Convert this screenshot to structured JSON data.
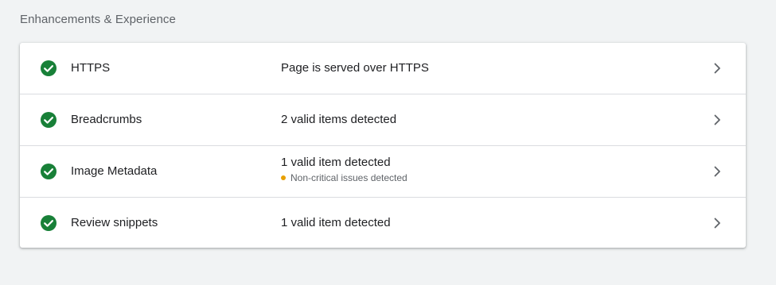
{
  "section": {
    "title": "Enhancements & Experience"
  },
  "colors": {
    "check": "#188038",
    "warning": "#e8a000",
    "chevron": "#5f6368"
  },
  "rows": [
    {
      "name": "HTTPS",
      "status": "Page is served over HTTPS",
      "icon": "check-circle-icon"
    },
    {
      "name": "Breadcrumbs",
      "status": "2 valid items detected",
      "icon": "check-circle-icon"
    },
    {
      "name": "Image Metadata",
      "status": "1 valid item detected",
      "sub_status": "Non-critical issues detected",
      "icon": "check-circle-icon"
    },
    {
      "name": "Review snippets",
      "status": "1 valid item detected",
      "icon": "check-circle-icon"
    }
  ]
}
